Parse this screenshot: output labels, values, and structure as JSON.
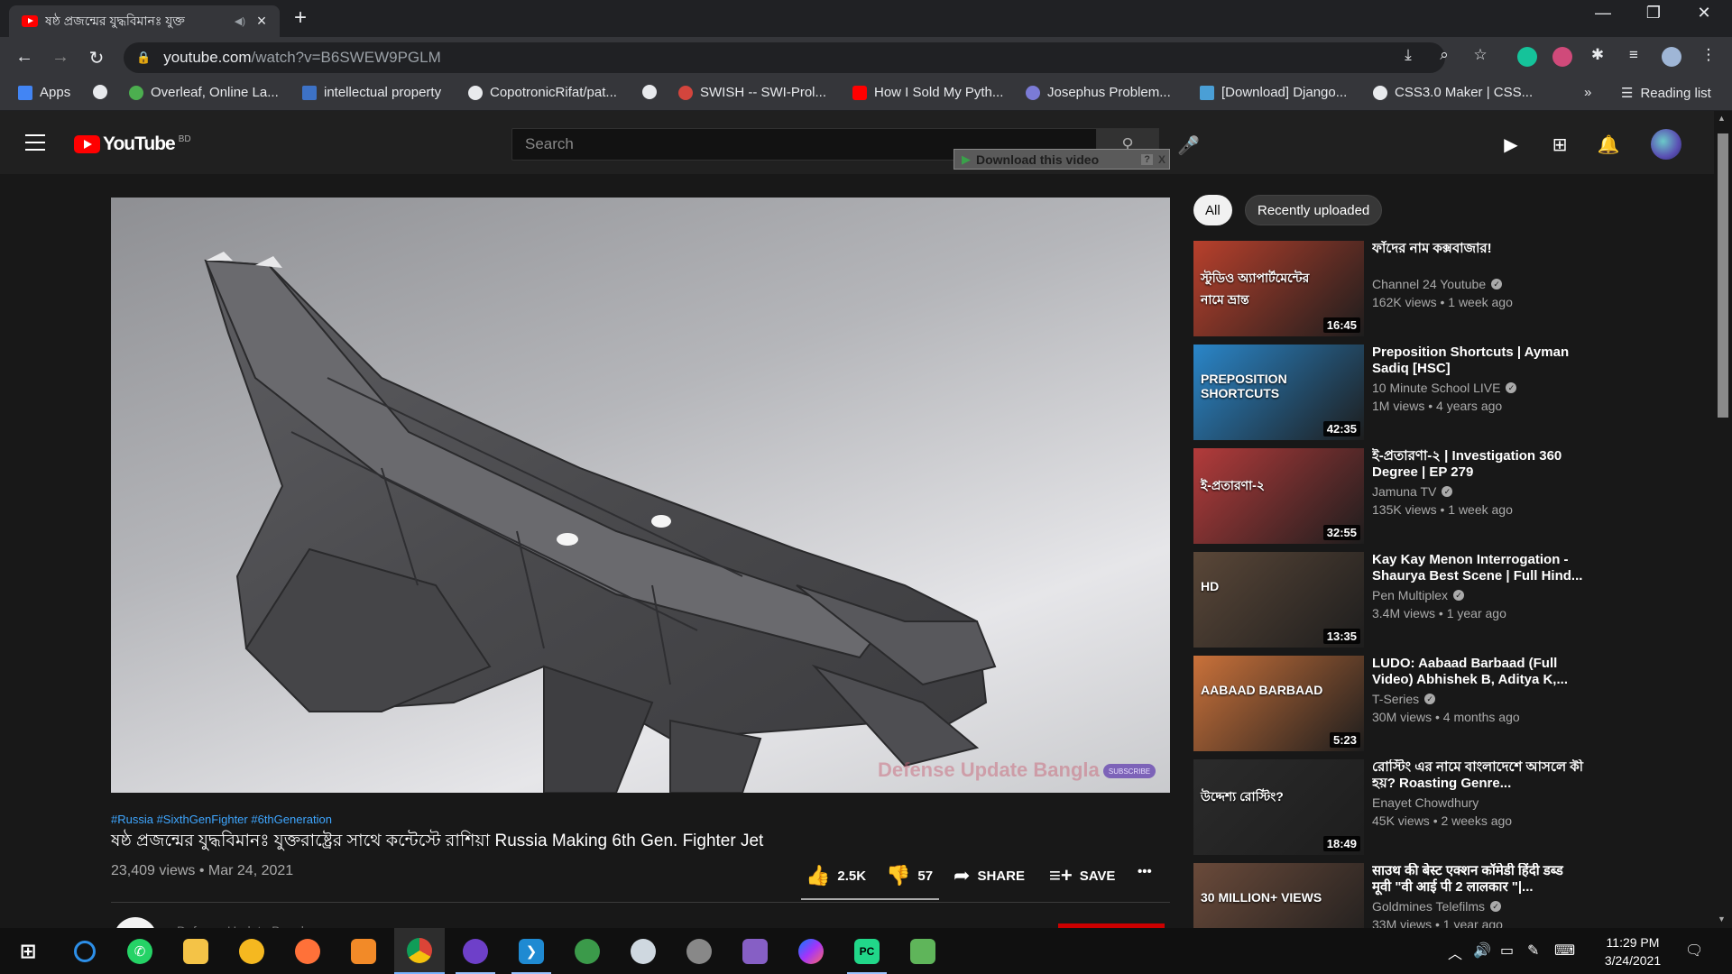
{
  "browser": {
    "tab_title": "ষষ্ঠ প্রজন্মের যুদ্ধবিমানঃ যুক্ত",
    "url_host": "youtube.com",
    "url_path": "/watch?v=B6SWEW9PGLM",
    "bookmarks": [
      {
        "label": "Apps",
        "color": "#4285f4"
      },
      {
        "label": "",
        "color": "#e8eaed"
      },
      {
        "label": "Overleaf, Online La...",
        "color": "#4cae4f"
      },
      {
        "label": "intellectual property",
        "color": "#3d72c6"
      },
      {
        "label": "CopotronicRifat/pat...",
        "color": "#e8eaed"
      },
      {
        "label": "",
        "color": "#e8eaed"
      },
      {
        "label": "SWISH -- SWI-Prol...",
        "color": "#d3453d"
      },
      {
        "label": "How I Sold My Pyth...",
        "color": "#ff0000"
      },
      {
        "label": "Josephus Problem...",
        "color": "#7b7bd6"
      },
      {
        "label": "[Download] Django...",
        "color": "#4a9fd6"
      },
      {
        "label": "CSS3.0 Maker | CSS...",
        "color": "#e8eaed"
      }
    ],
    "bookmarks_more": "»",
    "reading_list": "Reading list"
  },
  "youtube": {
    "logo_text": "YouTube",
    "country_code": "BD",
    "search_placeholder": "Search",
    "download_bar": "Download this video",
    "download_help": "?",
    "download_close": "X"
  },
  "video": {
    "watermark": "Defense Update Bangla",
    "watermark_sub": "SUBSCRIBE",
    "hashtags": "#Russia #SixthGenFighter #6thGeneration",
    "title": "ষষ্ঠ প্রজন্মের যুদ্ধবিমানঃ যুক্তরাষ্ট্রের সাথে কন্টেস্টে রাশিয়া Russia Making 6th Gen. Fighter Jet",
    "views": "23,409 views",
    "date": "Mar 24, 2021",
    "likes": "2.5K",
    "dislikes": "57",
    "share": "SHARE",
    "save": "SAVE",
    "more": "•••",
    "channel_peek": "Defense Update Bangla"
  },
  "chips": [
    "All",
    "Recently uploaded"
  ],
  "recommendations": [
    {
      "title": "ফাঁদের নাম কক্সবাজার!",
      "channel": "Channel 24 Youtube",
      "verified": true,
      "meta": "162K views • 1 week ago",
      "duration": "16:45",
      "thumb_color": "#b8402c",
      "thumb_text": "স্টুডিও অ্যাপার্টমেন্টের নামে ভ্রান্ত"
    },
    {
      "title": "Preposition Shortcuts | Ayman Sadiq [HSC]",
      "channel": "10 Minute School LIVE",
      "verified": true,
      "meta": "1M views • 4 years ago",
      "duration": "42:35",
      "thumb_color": "#2a86c9",
      "thumb_text": "PREPOSITION SHORTCUTS"
    },
    {
      "title": "ই-প্রতারণা-২ | Investigation 360 Degree | EP 279",
      "channel": "Jamuna TV",
      "verified": true,
      "meta": "135K views • 1 week ago",
      "duration": "32:55",
      "thumb_color": "#b33b3b",
      "thumb_text": "ই-প্রতারণা-২"
    },
    {
      "title": "Kay Kay Menon Interrogation - Shaurya Best Scene | Full Hind...",
      "channel": "Pen Multiplex",
      "verified": true,
      "meta": "3.4M views • 1 year ago",
      "duration": "13:35",
      "thumb_color": "#5a4738",
      "thumb_text": "HD"
    },
    {
      "title": "LUDO: Aabaad Barbaad (Full Video) Abhishek B, Aditya K,...",
      "channel": "T-Series",
      "verified": true,
      "meta": "30M views • 4 months ago",
      "duration": "5:23",
      "thumb_color": "#c9713a",
      "thumb_text": "AABAAD BARBAAD"
    },
    {
      "title": "রোস্টিং এর নামে বাংলাদেশে আসলে কী হয়? Roasting Genre...",
      "channel": "Enayet Chowdhury",
      "verified": false,
      "meta": "45K views • 2 weeks ago",
      "duration": "18:49",
      "thumb_color": "#2b2b2b",
      "thumb_text": "উদ্দেশ্য রোস্টিং?"
    },
    {
      "title": "साउथ की बेस्ट एक्शन कॉमेडी हिंदी डब्ड मूवी \"वी आई पी 2 लालकार \"|...",
      "channel": "Goldmines Telefilms",
      "verified": true,
      "meta": "33M views • 1 year ago",
      "duration": "",
      "thumb_color": "#6a4a3a",
      "thumb_text": "30 MILLION+ VIEWS"
    }
  ],
  "taskbar": {
    "time": "11:29 PM",
    "date": "3/24/2021"
  }
}
